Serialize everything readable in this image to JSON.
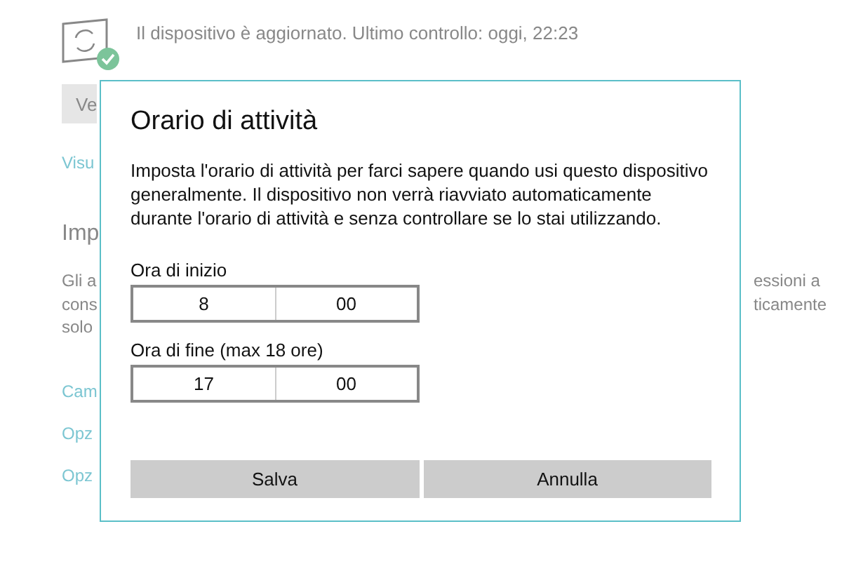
{
  "update_status": {
    "message": "Il dispositivo è aggiornato. Ultimo controllo: oggi, 22:23",
    "button": "Ve",
    "link": "Visu"
  },
  "section": {
    "heading": "Imp",
    "lines_left": [
      "Gli a",
      "cons",
      "solo"
    ],
    "lines_right": [
      "essioni a",
      "ticamente"
    ]
  },
  "links": [
    "Cam",
    "Opz",
    "Opz"
  ],
  "dialog": {
    "title": "Orario di attività",
    "description": "Imposta l'orario di attività per farci sapere quando usi questo dispositivo generalmente. Il dispositivo non verrà riavviato automaticamente durante l'orario di attività e senza controllare se lo stai utilizzando.",
    "fields": [
      {
        "label": "Ora di inizio",
        "hour": "8",
        "minute": "00"
      },
      {
        "label": "Ora di fine (max 18 ore)",
        "hour": "17",
        "minute": "00"
      }
    ],
    "buttons": [
      "Salva",
      "Annulla"
    ]
  }
}
